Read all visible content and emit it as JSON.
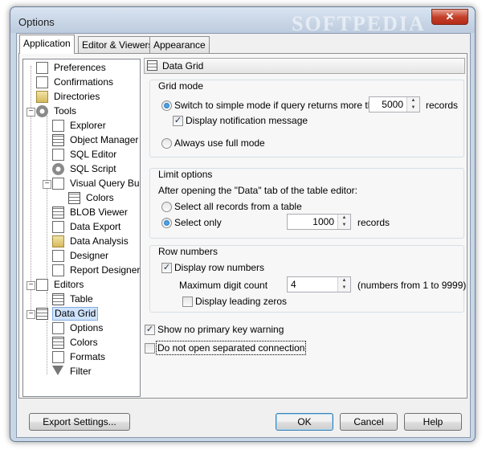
{
  "window": {
    "title": "Options",
    "watermark": "SOFTPEDIA",
    "close_glyph": "✕"
  },
  "tabs": [
    {
      "label": "Application",
      "active": true
    },
    {
      "label": "Editor & Viewers",
      "active": false
    },
    {
      "label": "Appearance",
      "active": false
    }
  ],
  "tree": {
    "preferences": "Preferences",
    "confirmations": "Confirmations",
    "directories": "Directories",
    "tools": "Tools",
    "explorer": "Explorer",
    "object_manager": "Object Manager",
    "sql_editor": "SQL Editor",
    "sql_script": "SQL Script",
    "visual_query_builder": "Visual Query Build",
    "colors_vqb": "Colors",
    "blob_viewer": "BLOB Viewer",
    "data_export": "Data Export",
    "data_analysis": "Data Analysis",
    "designer": "Designer",
    "report_designer": "Report Designer",
    "editors": "Editors",
    "table": "Table",
    "data_grid": "Data Grid",
    "options": "Options",
    "colors_grid": "Colors",
    "formats": "Formats",
    "filter": "Filter",
    "expand_minus": "−"
  },
  "panel": {
    "header": "Data Grid",
    "grid_mode": {
      "caption": "Grid mode",
      "switch_label": "Switch to simple mode if query returns more than",
      "switch_value": "5000",
      "switch_unit": "records",
      "notify_label": "Display notification message",
      "full_mode_label": "Always use full mode"
    },
    "limit_options": {
      "caption": "Limit options",
      "description": "After opening the \"Data\" tab of the table editor:",
      "select_all_label": "Select all records from a table",
      "select_only_label": "Select only",
      "select_only_value": "1000",
      "select_only_unit": "records"
    },
    "row_numbers": {
      "caption": "Row numbers",
      "display_label": "Display row numbers",
      "max_digit_label": "Maximum digit count",
      "max_digit_value": "4",
      "max_digit_hint": "(numbers from 1 to 9999)",
      "leading_zeros_label": "Display leading zeros"
    },
    "no_pk_warning_label": "Show no primary key warning",
    "no_separate_conn_label": "Do not open separated connection"
  },
  "footer": {
    "export_label": "Export Settings...",
    "ok_label": "OK",
    "cancel_label": "Cancel",
    "help_label": "Help"
  },
  "glyphs": {
    "check": "✓",
    "up": "▲",
    "down": "▼"
  },
  "colors": {
    "selection": "#cfe3fd",
    "accent": "#1d6ab8",
    "window_frame": "#c9d6e6"
  }
}
